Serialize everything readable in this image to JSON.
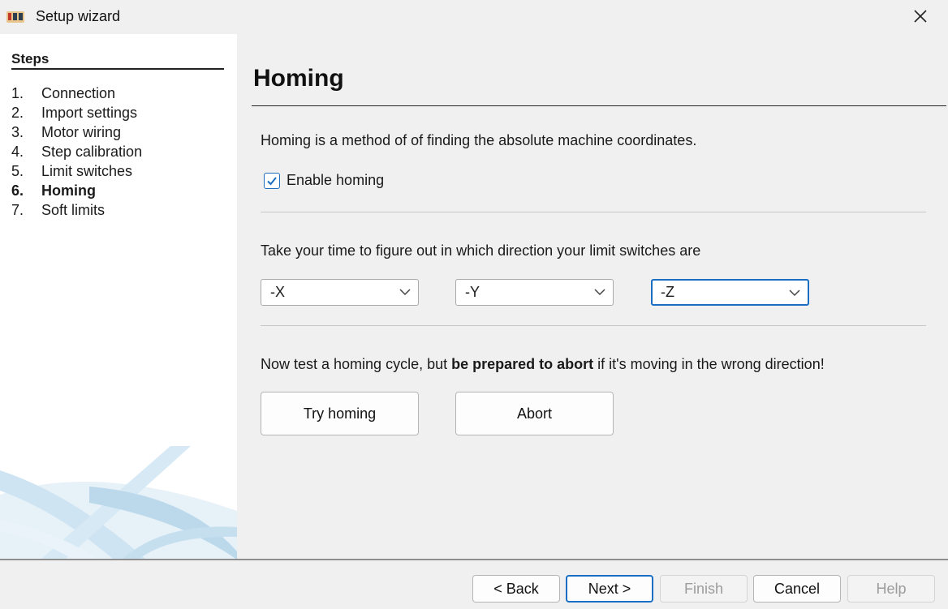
{
  "window": {
    "title": "Setup wizard",
    "icon": "ugs-logo-icon"
  },
  "sidebar": {
    "heading": "Steps",
    "steps": [
      {
        "num": "1.",
        "label": "Connection"
      },
      {
        "num": "2.",
        "label": "Import settings"
      },
      {
        "num": "3.",
        "label": "Motor wiring"
      },
      {
        "num": "4.",
        "label": "Step calibration"
      },
      {
        "num": "5.",
        "label": "Limit switches"
      },
      {
        "num": "6.",
        "label": "Homing"
      },
      {
        "num": "7.",
        "label": "Soft limits"
      }
    ],
    "active_step": 6
  },
  "main": {
    "title": "Homing",
    "intro": "Homing is a method of of finding the absolute machine coordinates.",
    "enable_homing": {
      "label": "Enable homing",
      "checked": true
    },
    "direction_prompt": "Take your time to figure out in which direction your limit switches are",
    "directions": {
      "x": "-X",
      "y": "-Y",
      "z": "-Z"
    },
    "test_prefix": "Now test a homing cycle, but ",
    "test_bold": "be prepared to abort",
    "test_suffix": " if it's moving in the wrong direction!",
    "try_button": "Try homing",
    "abort_button": "Abort"
  },
  "footer": {
    "back": "< Back",
    "next": "Next >",
    "finish": "Finish",
    "cancel": "Cancel",
    "help": "Help"
  },
  "colors": {
    "accent": "#1a6fc4",
    "sidebar_bg": "#ffffff",
    "window_bg": "#f0f0f0"
  }
}
